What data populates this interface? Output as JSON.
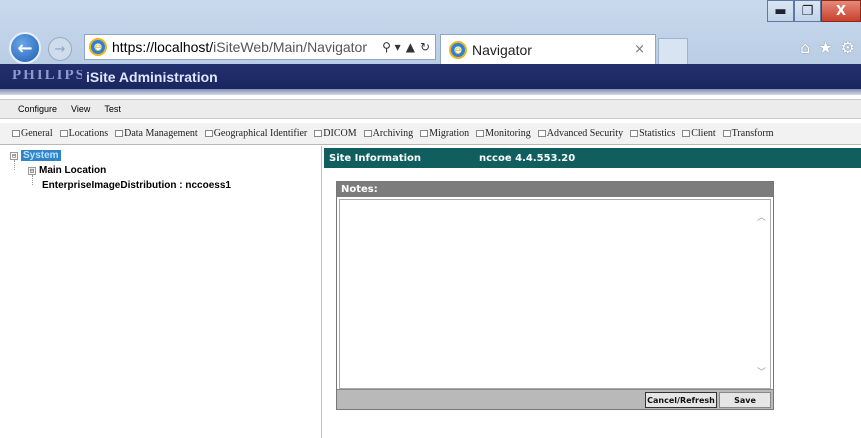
{
  "browser": {
    "url_scheme_host": "https://localhost/",
    "url_path": "iSiteWeb/Main/Navigator",
    "tab_title": "Navigator",
    "tab_close": "×",
    "back_glyph": "←",
    "forward_glyph": "→",
    "window_minimize": "▬",
    "window_restore": "❐",
    "window_close": "X",
    "home_glyph": "⌂",
    "favorites_glyph": "★",
    "tools_glyph": "⚙",
    "search_glyph": "⚲ ▾",
    "lock_glyph": "🔒",
    "refresh_glyph": "↻"
  },
  "app": {
    "brand": "PHILIPS",
    "title": "iSite Administration"
  },
  "menu": [
    "Configure",
    "View",
    "Test"
  ],
  "toolbar": [
    "General",
    "Locations",
    "Data Management",
    "Geographical Identifier",
    "DICOM",
    "Archiving",
    "Migration",
    "Monitoring",
    "Advanced Security",
    "Statistics",
    "Client",
    "Transform"
  ],
  "tree": {
    "root": "System",
    "root_expander": "⊟",
    "child": "Main Location",
    "child_expander": "⊟",
    "leaf": "EnterpriseImageDistribution : nccoess1"
  },
  "site_info": {
    "label": "Site Information",
    "value": "nccoe  4.4.553.20"
  },
  "notes": {
    "label": "Notes:",
    "content": "",
    "cancel_label": "Cancel/Refresh",
    "save_label": "Save",
    "scroll_up": "︿",
    "scroll_down": "﹀"
  },
  "colors": {
    "header_bg": "#1a265e",
    "info_bar_bg": "#105e5e",
    "selected_node_bg": "#2e86c9"
  }
}
